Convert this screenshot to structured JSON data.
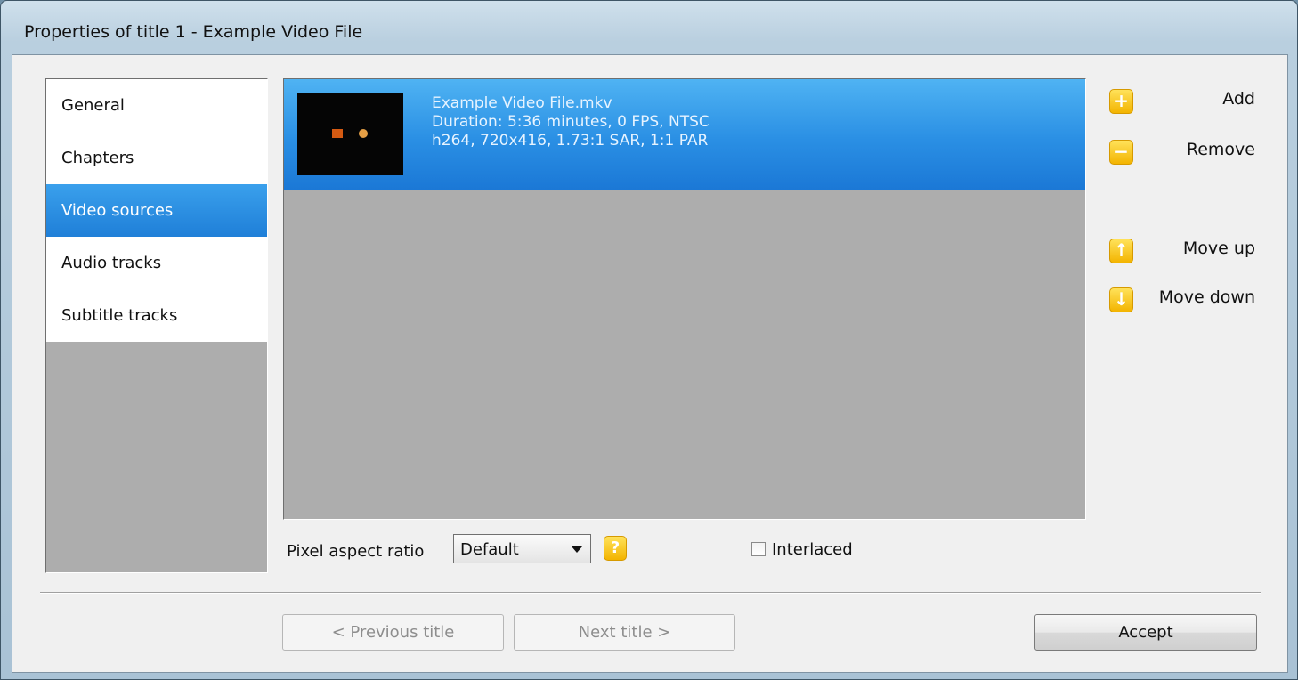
{
  "window": {
    "title": "Properties of title 1 - Example Video File"
  },
  "nav": {
    "items": [
      {
        "label": "General",
        "selected": false
      },
      {
        "label": "Chapters",
        "selected": false
      },
      {
        "label": "Video sources",
        "selected": true
      },
      {
        "label": "Audio tracks",
        "selected": false
      },
      {
        "label": "Subtitle tracks",
        "selected": false
      }
    ]
  },
  "sources": [
    {
      "filename": "Example Video File.mkv",
      "details1": "Duration: 5:36 minutes, 0 FPS, NTSC",
      "details2": "h264, 720x416, 1.73:1 SAR, 1:1 PAR",
      "selected": true
    }
  ],
  "actions": {
    "add": {
      "label": "Add",
      "icon": "plus-icon"
    },
    "remove": {
      "label": "Remove",
      "icon": "minus-icon"
    },
    "move_up": {
      "label": "Move up",
      "icon": "arrow-up-icon"
    },
    "move_down": {
      "label": "Move down",
      "icon": "arrow-down-icon"
    }
  },
  "options": {
    "pixel_aspect_label": "Pixel aspect ratio",
    "pixel_aspect_value": "Default",
    "help_icon": "question-icon",
    "interlaced_label": "Interlaced",
    "interlaced_checked": false
  },
  "footer": {
    "previous_label": "< Previous title",
    "next_label": "Next title >",
    "accept_label": "Accept"
  },
  "colors": {
    "selection": "#2a8fe4",
    "icon_yellow": "#f3b400"
  }
}
